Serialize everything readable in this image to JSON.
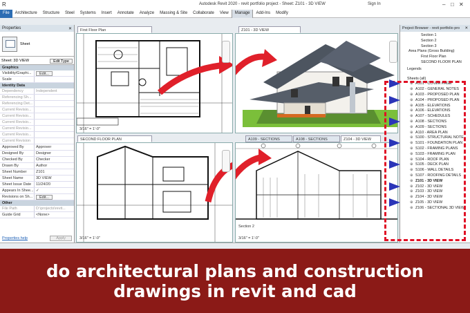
{
  "titlebar": {
    "title": "Autodesk Revit 2020 - revit portfolio project - Sheet: Z101 - 3D VIEW",
    "signin": "Sign In"
  },
  "ribbon": {
    "tabs": [
      "File",
      "Architecture",
      "Structure",
      "Steel",
      "Systems",
      "Insert",
      "Annotate",
      "Analyze",
      "Massing & Site",
      "Collaborate",
      "View",
      "Manage",
      "Add-Ins",
      "Modify"
    ]
  },
  "properties": {
    "header": "Properties",
    "type_name": "Sheet",
    "selector": "Sheet: 3D VIEW",
    "edit_type": "Edit Type",
    "groups": {
      "graphics": "Graphics",
      "identity": "Identity Data",
      "other": "Other"
    },
    "graphics_rows": [
      {
        "k": "Visibility/Graphi...",
        "v": "Edit..."
      },
      {
        "k": "Scale",
        "v": ""
      }
    ],
    "identity_rows": [
      {
        "k": "Dependency",
        "v": "Independent",
        "dim": true
      },
      {
        "k": "Referencing Sh...",
        "v": "",
        "dim": true
      },
      {
        "k": "Referencing Det...",
        "v": "",
        "dim": true
      },
      {
        "k": "Current Revisio...",
        "v": "",
        "dim": true
      },
      {
        "k": "Current Revisio...",
        "v": "",
        "dim": true
      },
      {
        "k": "Current Revisio...",
        "v": "",
        "dim": true
      },
      {
        "k": "Current Revisio...",
        "v": "",
        "dim": true
      },
      {
        "k": "Current Revisio...",
        "v": "",
        "dim": true
      },
      {
        "k": "Current Revision",
        "v": "",
        "dim": true
      },
      {
        "k": "Approved By",
        "v": "Approver"
      },
      {
        "k": "Designed By",
        "v": "Designer"
      },
      {
        "k": "Checked By",
        "v": "Checker"
      },
      {
        "k": "Drawn By",
        "v": "Author"
      },
      {
        "k": "Sheet Number",
        "v": "Z101"
      },
      {
        "k": "Sheet Name",
        "v": "3D VIEW"
      },
      {
        "k": "Sheet Issue Date",
        "v": "11/24/20"
      },
      {
        "k": "Appears In Shee...",
        "v": "✓"
      },
      {
        "k": "Revisions on Sh...",
        "v": "Edit..."
      }
    ],
    "other_rows": [
      {
        "k": "File Path",
        "v": "D:\\projects\\revit...",
        "dim": true
      },
      {
        "k": "Guide Grid",
        "v": "<None>"
      }
    ],
    "help_link": "Properties help",
    "apply": "Apply"
  },
  "views": {
    "first_floor": {
      "tab": "First Floor Plan",
      "scale": "3/16\" = 1'-0\""
    },
    "z101": {
      "tab": "Z101 - 3D VIEW"
    },
    "second_floor": {
      "tab": "SECOND FLOOR PLAN",
      "scale": "3/16\" = 1'-0\""
    },
    "tabs_lower": [
      "A109 - SECTIONS",
      "A108 - SECTIONS",
      "Z104 - 3D VIEW"
    ],
    "section_scale": "3/16\" = 1'-0\"",
    "section_label": "Section 2"
  },
  "browser": {
    "header": "Project Browser - revit portfolio pro",
    "top_items": [
      "Section 1",
      "Section 2",
      "Section 3"
    ],
    "area_plans": "Area Plans (Gross Building)",
    "area_items": [
      "First Floor Plan",
      "SECOND FLOOR PLAN"
    ],
    "legends": "Legends",
    "sheets_all": "Sheets (all)",
    "sheets": [
      {
        "label": "A101 - COVER PAGE",
        "bold": false
      },
      {
        "label": "A102 - GENERAL NOTES",
        "bold": false
      },
      {
        "label": "A103 - PROPOSED PLAN",
        "bold": false
      },
      {
        "label": "A104 - PROPOSED PLAN",
        "bold": false
      },
      {
        "label": "A105 - ELEVATIONS",
        "bold": false
      },
      {
        "label": "A106 - ELEVATIONS",
        "bold": false
      },
      {
        "label": "A107 - SCHEDULES",
        "bold": false
      },
      {
        "label": "A108 - SECTIONS",
        "bold": false
      },
      {
        "label": "A109 - SECTIONS",
        "bold": false
      },
      {
        "label": "A110 - AREA PLAN",
        "bold": false
      },
      {
        "label": "S100 - STRUCTURAL NOTE",
        "bold": false
      },
      {
        "label": "S101 - FOUNDATION PLAN",
        "bold": false
      },
      {
        "label": "S102 - FRAMING PLANS",
        "bold": false
      },
      {
        "label": "S103 - FRAMING PLAN",
        "bold": false
      },
      {
        "label": "S104 - ROOF PLAN",
        "bold": false
      },
      {
        "label": "S105 - DECK PLAN",
        "bold": false
      },
      {
        "label": "S106 - WALL DETAILS",
        "bold": false
      },
      {
        "label": "S107 - ROOFING DETAILS",
        "bold": false
      },
      {
        "label": "Z101 - 3D VIEW",
        "bold": true
      },
      {
        "label": "Z102 - 3D VIEW",
        "bold": false
      },
      {
        "label": "Z103 - 3D VIEW",
        "bold": false
      },
      {
        "label": "Z104 - 3D VIEW",
        "bold": false
      },
      {
        "label": "Z105 - 3D VIEW",
        "bold": false
      },
      {
        "label": "Z106 - SECTIONAL 3D VIEW",
        "bold": false
      }
    ]
  },
  "banner": {
    "line1": "do architectural plans and construction",
    "line2": "drawings in revit and cad"
  },
  "colors": {
    "banner": "#8b1a17",
    "arrow_red": "#e0202a",
    "dash_red": "#e01025",
    "marker_blue": "#2a35b8",
    "file_tab": "#2d6db3"
  }
}
